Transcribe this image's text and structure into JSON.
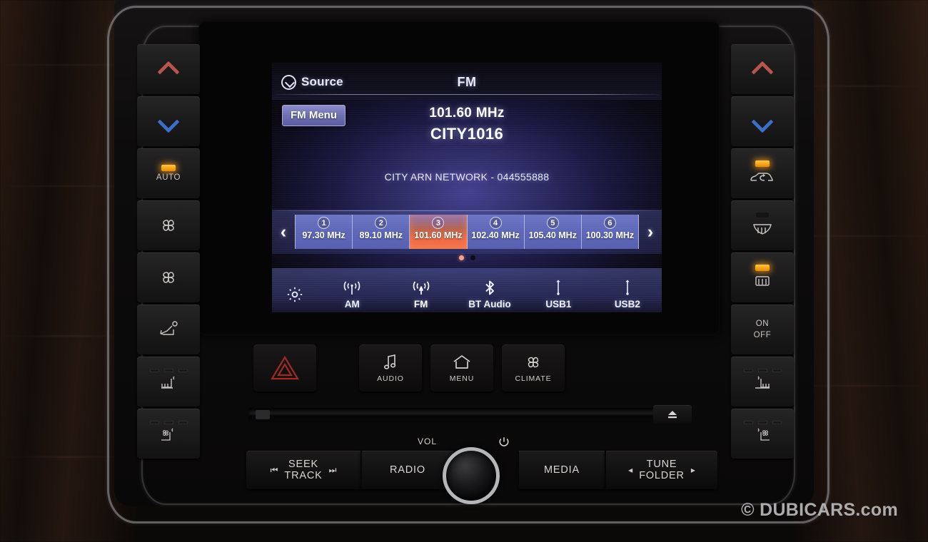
{
  "display": {
    "header": {
      "source_label": "Source",
      "source_icon": "circle-chevron-down-icon",
      "band": "FM"
    },
    "fm_menu_label": "FM Menu",
    "frequency": "101.60 MHz",
    "station_name": "CITY1016",
    "rds_text": "CITY ARN NETWORK - 044555888",
    "presets": [
      {
        "num": "1",
        "freq": "97.30 MHz",
        "active": false
      },
      {
        "num": "2",
        "freq": "89.10 MHz",
        "active": false
      },
      {
        "num": "3",
        "freq": "101.60 MHz",
        "active": true
      },
      {
        "num": "4",
        "freq": "102.40 MHz",
        "active": false
      },
      {
        "num": "5",
        "freq": "105.40 MHz",
        "active": false
      },
      {
        "num": "6",
        "freq": "100.30 MHz",
        "active": false
      }
    ],
    "prev_arrow": "‹",
    "next_arrow": "›",
    "page_dots": {
      "count": 2,
      "active_index": 0
    },
    "sources": [
      {
        "label": "AM",
        "icon": "am-antenna-icon",
        "active": false
      },
      {
        "label": "FM",
        "icon": "fm-antenna-icon",
        "active": true
      },
      {
        "label": "BT Audio",
        "icon": "bluetooth-icon",
        "active": false
      },
      {
        "label": "USB1",
        "icon": "usb-icon",
        "active": false
      },
      {
        "label": "USB2",
        "icon": "usb-icon",
        "active": false
      }
    ],
    "settings_icon": "gear-icon",
    "colors": {
      "accent_orange": "#f0663a",
      "screen_purple": "#44408f",
      "fm_menu_violet": "#6e70b4"
    }
  },
  "left_buttons": [
    {
      "name": "temp-up",
      "label": "",
      "icon": "chevron-up-red-icon",
      "led": "none"
    },
    {
      "name": "temp-down",
      "label": "",
      "icon": "chevron-down-blue-icon",
      "led": "none"
    },
    {
      "name": "auto",
      "label": "AUTO",
      "icon": "",
      "led": "on"
    },
    {
      "name": "fan-up",
      "label": "",
      "icon": "fan-icon",
      "led": "none"
    },
    {
      "name": "fan-down",
      "label": "",
      "icon": "fan-icon",
      "led": "none"
    },
    {
      "name": "air-direction",
      "label": "",
      "icon": "airflow-seat-icon",
      "led": "none"
    },
    {
      "name": "seat-heater-left",
      "label": "",
      "icon": "seat-heat-icon",
      "led": "levels"
    },
    {
      "name": "seat-vent-left",
      "label": "",
      "icon": "seat-fan-icon",
      "led": "levels"
    }
  ],
  "right_buttons": [
    {
      "name": "temp-up",
      "label": "",
      "icon": "chevron-up-red-icon",
      "led": "none"
    },
    {
      "name": "temp-down",
      "label": "",
      "icon": "chevron-down-blue-icon",
      "led": "none"
    },
    {
      "name": "recirculation",
      "label": "",
      "icon": "recirculate-car-icon",
      "led": "on"
    },
    {
      "name": "front-defrost",
      "label": "",
      "icon": "front-defrost-icon",
      "led": "off"
    },
    {
      "name": "rear-defrost",
      "label": "",
      "icon": "rear-defrost-icon",
      "led": "on"
    },
    {
      "name": "ac-power",
      "label": "ON\nOFF",
      "icon": "",
      "led": "none"
    },
    {
      "name": "seat-heater-right",
      "label": "",
      "icon": "seat-heat-icon",
      "led": "levels"
    },
    {
      "name": "seat-vent-right",
      "label": "",
      "icon": "seat-fan-icon",
      "led": "levels"
    }
  ],
  "mid_buttons": [
    {
      "name": "hazard",
      "label": "",
      "icon": "hazard-triangle-icon"
    },
    {
      "name": "audio",
      "label": "AUDIO",
      "icon": "music-note-icon"
    },
    {
      "name": "menu",
      "label": "MENU",
      "icon": "home-icon"
    },
    {
      "name": "climate",
      "label": "CLIMATE",
      "icon": "fan-icon"
    }
  ],
  "bottom_row": {
    "vol_label": "VOL",
    "power_icon": "power-icon",
    "eject_icon": "eject-icon",
    "seek": {
      "line1": "SEEK",
      "line2": "TRACK",
      "prev_icon": "⏮",
      "next_icon": "⏭"
    },
    "radio_label": "RADIO",
    "media_label": "MEDIA",
    "tune": {
      "line1": "TUNE",
      "line2": "FOLDER",
      "left_icon": "◂",
      "right_icon": "▸"
    }
  },
  "watermark": "© DUBICARS.com"
}
